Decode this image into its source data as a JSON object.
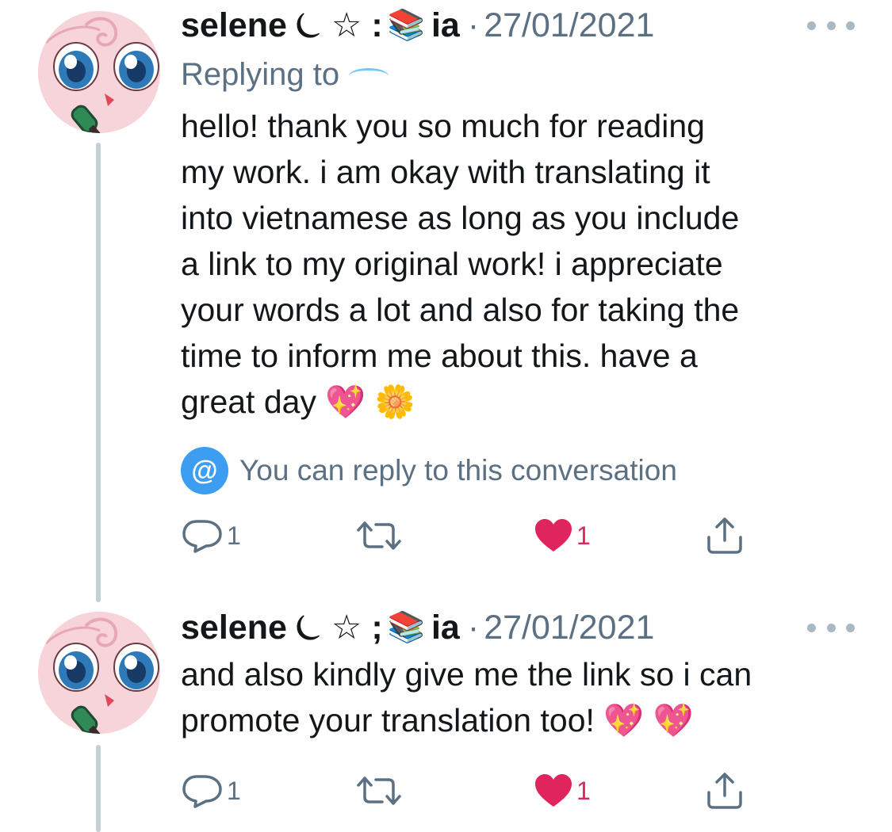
{
  "tweets": [
    {
      "display_name": "selene",
      "name_glyphs": "⏾ ☆ :",
      "name_book": "📚",
      "name_suffix": "ia",
      "separator": "·",
      "date": "27/01/2021",
      "replying_label": "Replying to",
      "text": "hello! thank you so much for reading\nmy work. i am okay with translating it\ninto vietnamese as long as you include\na link to my original work! i appreciate\nyour words a lot and also for taking the\ntime to inform me about this. have a\ngreat day 💖 🌼",
      "reply_notice_icon": "@",
      "reply_notice": "You can reply to this conversation",
      "reply_count": "1",
      "like_count": "1",
      "liked": true
    },
    {
      "display_name": "selene",
      "name_glyphs": "⏾ ☆ ;",
      "name_book": "📚",
      "name_suffix": "ia",
      "separator": "·",
      "date": "27/01/2021",
      "text": "and also kindly give me the link so i can\npromote your translation too! 💖 💖",
      "reply_count": "1",
      "like_count": "1",
      "liked": true
    }
  ],
  "icons": {
    "reply": "reply-bubble-icon",
    "retweet": "retweet-icon",
    "like": "heart-icon",
    "share": "share-icon",
    "more": "more-dots-icon"
  },
  "colors": {
    "like": "#e0245e",
    "secondary_text": "#5b7083",
    "accent": "#1da1f2",
    "thread_line": "#c4cfd6"
  }
}
